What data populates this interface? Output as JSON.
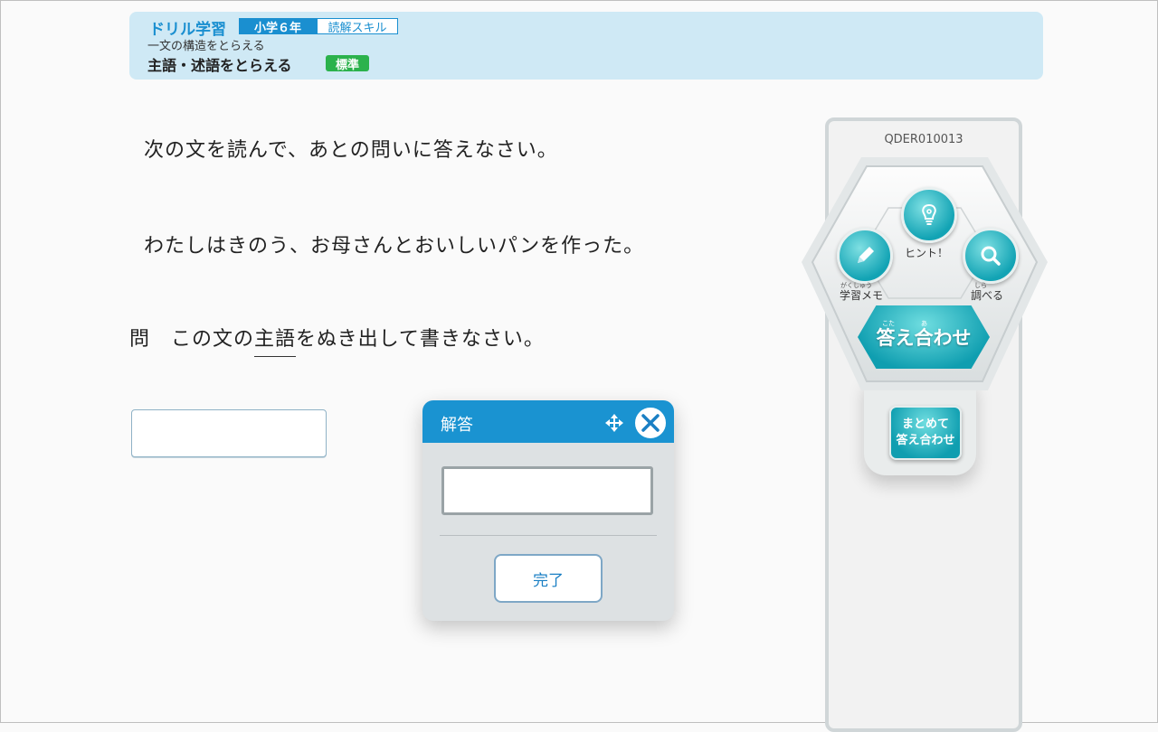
{
  "header": {
    "brand": "ドリル学習",
    "grade": "小学６年",
    "skill": "読解スキル",
    "unit": "一文の構造をとらえる",
    "lesson": "主語・述語をとらえる",
    "level": "標準"
  },
  "question": {
    "instruction": "次の文を読んで、あとの問いに答えなさい。",
    "sentence": "わたしはきのう、お母さんとおいしいパンを作った。",
    "prompt_prefix": "問　この文の",
    "prompt_underlined": "主語",
    "prompt_suffix": "をぬき出して書きなさい。",
    "answer_value": ""
  },
  "dialog": {
    "title": "解答",
    "input_value": "",
    "done_label": "完了"
  },
  "panel": {
    "question_id": "QDER010013",
    "hint_label": "ヒント！",
    "memo_label": "学習メモ",
    "memo_ruby": "がくしゅう",
    "search_label": "調べる",
    "search_ruby": "しら",
    "check_label": "答え合わせ",
    "check_ruby_1": "こた",
    "check_ruby_2": "あ",
    "bulk_line1": "まとめて",
    "bulk_line2": "答え合わせ"
  },
  "icons": {
    "hint": "lightbulb-icon",
    "memo": "pencil-icon",
    "search": "magnifier-icon",
    "move": "move-arrows-icon",
    "close": "close-x-icon"
  },
  "colors": {
    "header_bg": "#cfe9f5",
    "brand_blue": "#1a8fd0",
    "level_green": "#2bb24c",
    "teal": "#12a3b4"
  }
}
